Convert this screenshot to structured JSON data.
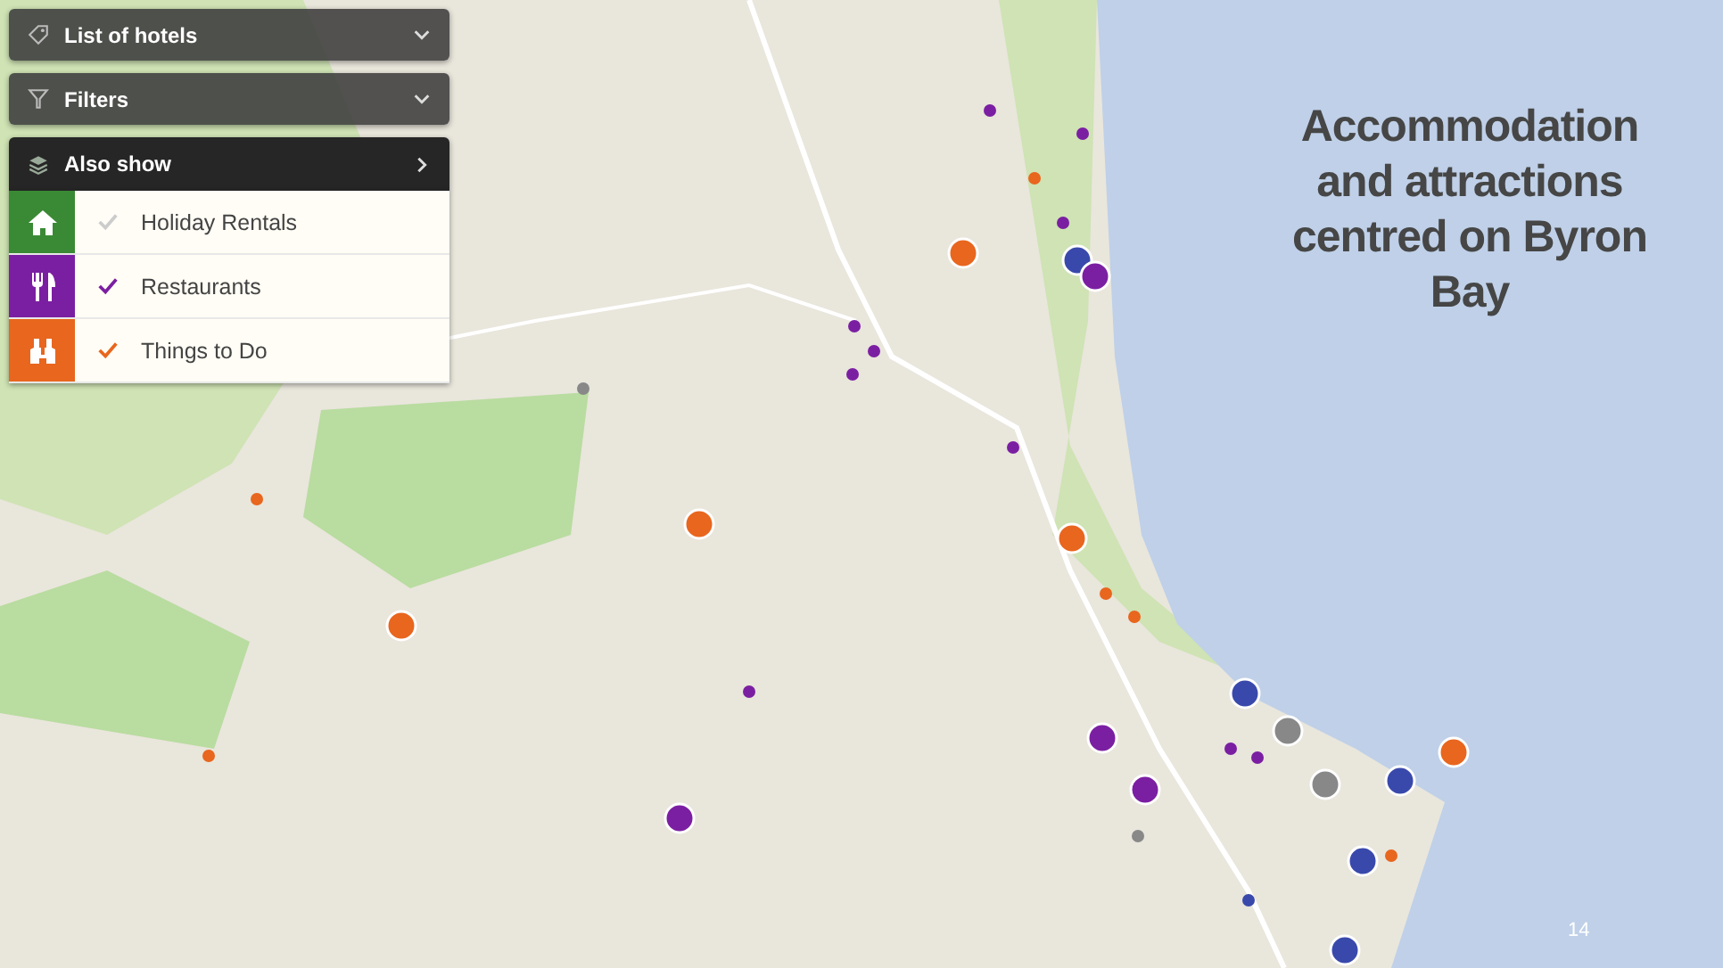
{
  "panels": [
    {
      "label": "List of hotels",
      "expanded": false
    },
    {
      "label": "Filters",
      "expanded": false
    }
  ],
  "also_show": {
    "label": "Also show",
    "expanded": true,
    "items": [
      {
        "label": "Holiday Rentals",
        "color": "#3a8a35",
        "checked": false
      },
      {
        "label": "Restaurants",
        "color": "#7b1fa2",
        "checked": true
      },
      {
        "label": "Things to Do",
        "color": "#e8661e",
        "checked": true
      }
    ]
  },
  "slide_title": "Accommodation and attractions centred on Byron Bay",
  "page_number": "14"
}
